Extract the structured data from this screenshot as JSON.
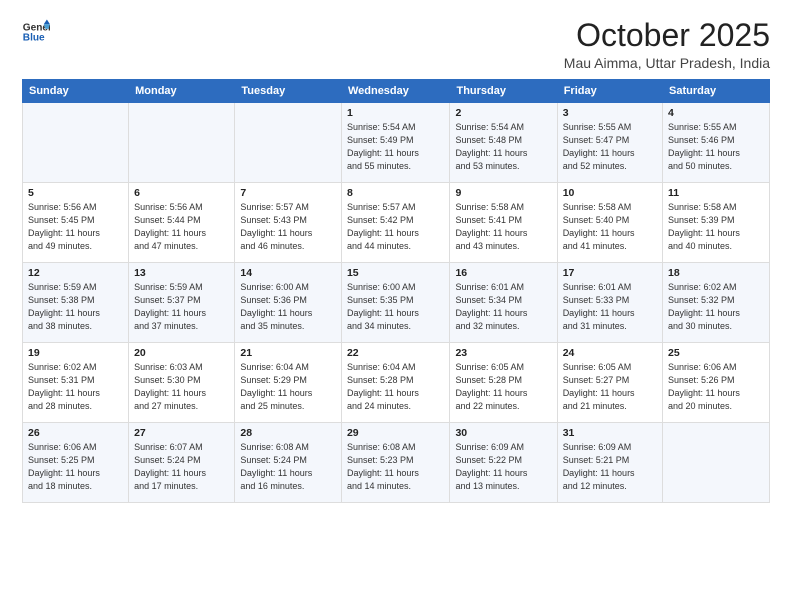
{
  "logo": {
    "line1": "General",
    "line2": "Blue"
  },
  "title": "October 2025",
  "location": "Mau Aimma, Uttar Pradesh, India",
  "weekdays": [
    "Sunday",
    "Monday",
    "Tuesday",
    "Wednesday",
    "Thursday",
    "Friday",
    "Saturday"
  ],
  "weeks": [
    [
      {
        "day": "",
        "info": ""
      },
      {
        "day": "",
        "info": ""
      },
      {
        "day": "",
        "info": ""
      },
      {
        "day": "1",
        "info": "Sunrise: 5:54 AM\nSunset: 5:49 PM\nDaylight: 11 hours\nand 55 minutes."
      },
      {
        "day": "2",
        "info": "Sunrise: 5:54 AM\nSunset: 5:48 PM\nDaylight: 11 hours\nand 53 minutes."
      },
      {
        "day": "3",
        "info": "Sunrise: 5:55 AM\nSunset: 5:47 PM\nDaylight: 11 hours\nand 52 minutes."
      },
      {
        "day": "4",
        "info": "Sunrise: 5:55 AM\nSunset: 5:46 PM\nDaylight: 11 hours\nand 50 minutes."
      }
    ],
    [
      {
        "day": "5",
        "info": "Sunrise: 5:56 AM\nSunset: 5:45 PM\nDaylight: 11 hours\nand 49 minutes."
      },
      {
        "day": "6",
        "info": "Sunrise: 5:56 AM\nSunset: 5:44 PM\nDaylight: 11 hours\nand 47 minutes."
      },
      {
        "day": "7",
        "info": "Sunrise: 5:57 AM\nSunset: 5:43 PM\nDaylight: 11 hours\nand 46 minutes."
      },
      {
        "day": "8",
        "info": "Sunrise: 5:57 AM\nSunset: 5:42 PM\nDaylight: 11 hours\nand 44 minutes."
      },
      {
        "day": "9",
        "info": "Sunrise: 5:58 AM\nSunset: 5:41 PM\nDaylight: 11 hours\nand 43 minutes."
      },
      {
        "day": "10",
        "info": "Sunrise: 5:58 AM\nSunset: 5:40 PM\nDaylight: 11 hours\nand 41 minutes."
      },
      {
        "day": "11",
        "info": "Sunrise: 5:58 AM\nSunset: 5:39 PM\nDaylight: 11 hours\nand 40 minutes."
      }
    ],
    [
      {
        "day": "12",
        "info": "Sunrise: 5:59 AM\nSunset: 5:38 PM\nDaylight: 11 hours\nand 38 minutes."
      },
      {
        "day": "13",
        "info": "Sunrise: 5:59 AM\nSunset: 5:37 PM\nDaylight: 11 hours\nand 37 minutes."
      },
      {
        "day": "14",
        "info": "Sunrise: 6:00 AM\nSunset: 5:36 PM\nDaylight: 11 hours\nand 35 minutes."
      },
      {
        "day": "15",
        "info": "Sunrise: 6:00 AM\nSunset: 5:35 PM\nDaylight: 11 hours\nand 34 minutes."
      },
      {
        "day": "16",
        "info": "Sunrise: 6:01 AM\nSunset: 5:34 PM\nDaylight: 11 hours\nand 32 minutes."
      },
      {
        "day": "17",
        "info": "Sunrise: 6:01 AM\nSunset: 5:33 PM\nDaylight: 11 hours\nand 31 minutes."
      },
      {
        "day": "18",
        "info": "Sunrise: 6:02 AM\nSunset: 5:32 PM\nDaylight: 11 hours\nand 30 minutes."
      }
    ],
    [
      {
        "day": "19",
        "info": "Sunrise: 6:02 AM\nSunset: 5:31 PM\nDaylight: 11 hours\nand 28 minutes."
      },
      {
        "day": "20",
        "info": "Sunrise: 6:03 AM\nSunset: 5:30 PM\nDaylight: 11 hours\nand 27 minutes."
      },
      {
        "day": "21",
        "info": "Sunrise: 6:04 AM\nSunset: 5:29 PM\nDaylight: 11 hours\nand 25 minutes."
      },
      {
        "day": "22",
        "info": "Sunrise: 6:04 AM\nSunset: 5:28 PM\nDaylight: 11 hours\nand 24 minutes."
      },
      {
        "day": "23",
        "info": "Sunrise: 6:05 AM\nSunset: 5:28 PM\nDaylight: 11 hours\nand 22 minutes."
      },
      {
        "day": "24",
        "info": "Sunrise: 6:05 AM\nSunset: 5:27 PM\nDaylight: 11 hours\nand 21 minutes."
      },
      {
        "day": "25",
        "info": "Sunrise: 6:06 AM\nSunset: 5:26 PM\nDaylight: 11 hours\nand 20 minutes."
      }
    ],
    [
      {
        "day": "26",
        "info": "Sunrise: 6:06 AM\nSunset: 5:25 PM\nDaylight: 11 hours\nand 18 minutes."
      },
      {
        "day": "27",
        "info": "Sunrise: 6:07 AM\nSunset: 5:24 PM\nDaylight: 11 hours\nand 17 minutes."
      },
      {
        "day": "28",
        "info": "Sunrise: 6:08 AM\nSunset: 5:24 PM\nDaylight: 11 hours\nand 16 minutes."
      },
      {
        "day": "29",
        "info": "Sunrise: 6:08 AM\nSunset: 5:23 PM\nDaylight: 11 hours\nand 14 minutes."
      },
      {
        "day": "30",
        "info": "Sunrise: 6:09 AM\nSunset: 5:22 PM\nDaylight: 11 hours\nand 13 minutes."
      },
      {
        "day": "31",
        "info": "Sunrise: 6:09 AM\nSunset: 5:21 PM\nDaylight: 11 hours\nand 12 minutes."
      },
      {
        "day": "",
        "info": ""
      }
    ]
  ]
}
